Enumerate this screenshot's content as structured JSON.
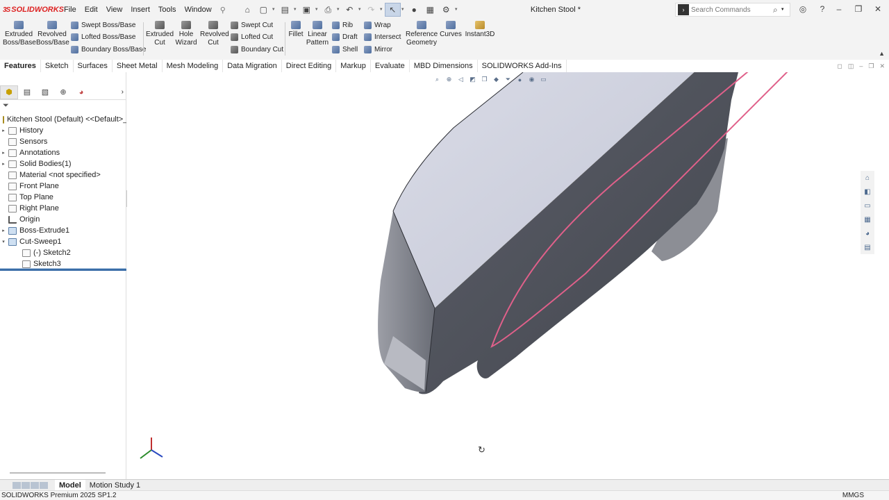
{
  "app": {
    "brand": "SOLIDWORKS",
    "document_title": "Kitchen Stool *"
  },
  "menu": [
    "File",
    "Edit",
    "View",
    "Insert",
    "Tools",
    "Window"
  ],
  "search": {
    "placeholder": "Search Commands"
  },
  "ribbon": {
    "extruded_boss": "Extruded Boss/Base",
    "revolved_boss": "Revolved Boss/Base",
    "swept_boss": "Swept Boss/Base",
    "lofted_boss": "Lofted Boss/Base",
    "boundary_boss": "Boundary Boss/Base",
    "extruded_cut": "Extruded Cut",
    "hole_wizard": "Hole Wizard",
    "revolved_cut": "Revolved Cut",
    "swept_cut": "Swept Cut",
    "lofted_cut": "Lofted Cut",
    "boundary_cut": "Boundary Cut",
    "fillet": "Fillet",
    "linear_pattern": "Linear Pattern",
    "rib": "Rib",
    "draft": "Draft",
    "shell": "Shell",
    "wrap": "Wrap",
    "intersect": "Intersect",
    "mirror": "Mirror",
    "reference_geometry": "Reference Geometry",
    "curves": "Curves",
    "instant3d": "Instant3D"
  },
  "tabs": [
    "Features",
    "Sketch",
    "Surfaces",
    "Sheet Metal",
    "Mesh Modeling",
    "Data Migration",
    "Direct Editing",
    "Markup",
    "Evaluate",
    "MBD Dimensions",
    "SOLIDWORKS Add-Ins"
  ],
  "tree": {
    "root": "Kitchen Stool (Default) <<Default>_I",
    "items": [
      {
        "label": "History",
        "expand": "▸",
        "icon": "history-icon"
      },
      {
        "label": "Sensors",
        "expand": "",
        "icon": "sensors-icon"
      },
      {
        "label": "Annotations",
        "expand": "▸",
        "icon": "annotations-icon"
      },
      {
        "label": "Solid Bodies(1)",
        "expand": "▸",
        "icon": "solid-bodies-icon"
      },
      {
        "label": "Material <not specified>",
        "expand": "",
        "icon": "material-icon"
      },
      {
        "label": "Front Plane",
        "expand": "",
        "icon": "plane-icon"
      },
      {
        "label": "Top Plane",
        "expand": "",
        "icon": "plane-icon"
      },
      {
        "label": "Right Plane",
        "expand": "",
        "icon": "plane-icon"
      },
      {
        "label": "Origin",
        "expand": "",
        "icon": "origin-icon"
      },
      {
        "label": "Boss-Extrude1",
        "expand": "▸",
        "icon": "boss-extrude-icon"
      },
      {
        "label": "Cut-Sweep1",
        "expand": "▾",
        "icon": "cut-sweep-icon"
      },
      {
        "label": "(-) Sketch2",
        "expand": "",
        "icon": "sketch-icon",
        "indent": true
      },
      {
        "label": "Sketch3",
        "expand": "",
        "icon": "sketch-icon",
        "indent": true
      }
    ]
  },
  "bottom_tabs": {
    "model": "Model",
    "motion": "Motion Study 1"
  },
  "status": {
    "version": "SOLIDWORKS Premium 2025 SP1.2",
    "units": "MMGS"
  },
  "colors": {
    "brand_red": "#d22222",
    "sweep_path": "#e0608a",
    "rollback_bar": "#3b6ea8"
  }
}
